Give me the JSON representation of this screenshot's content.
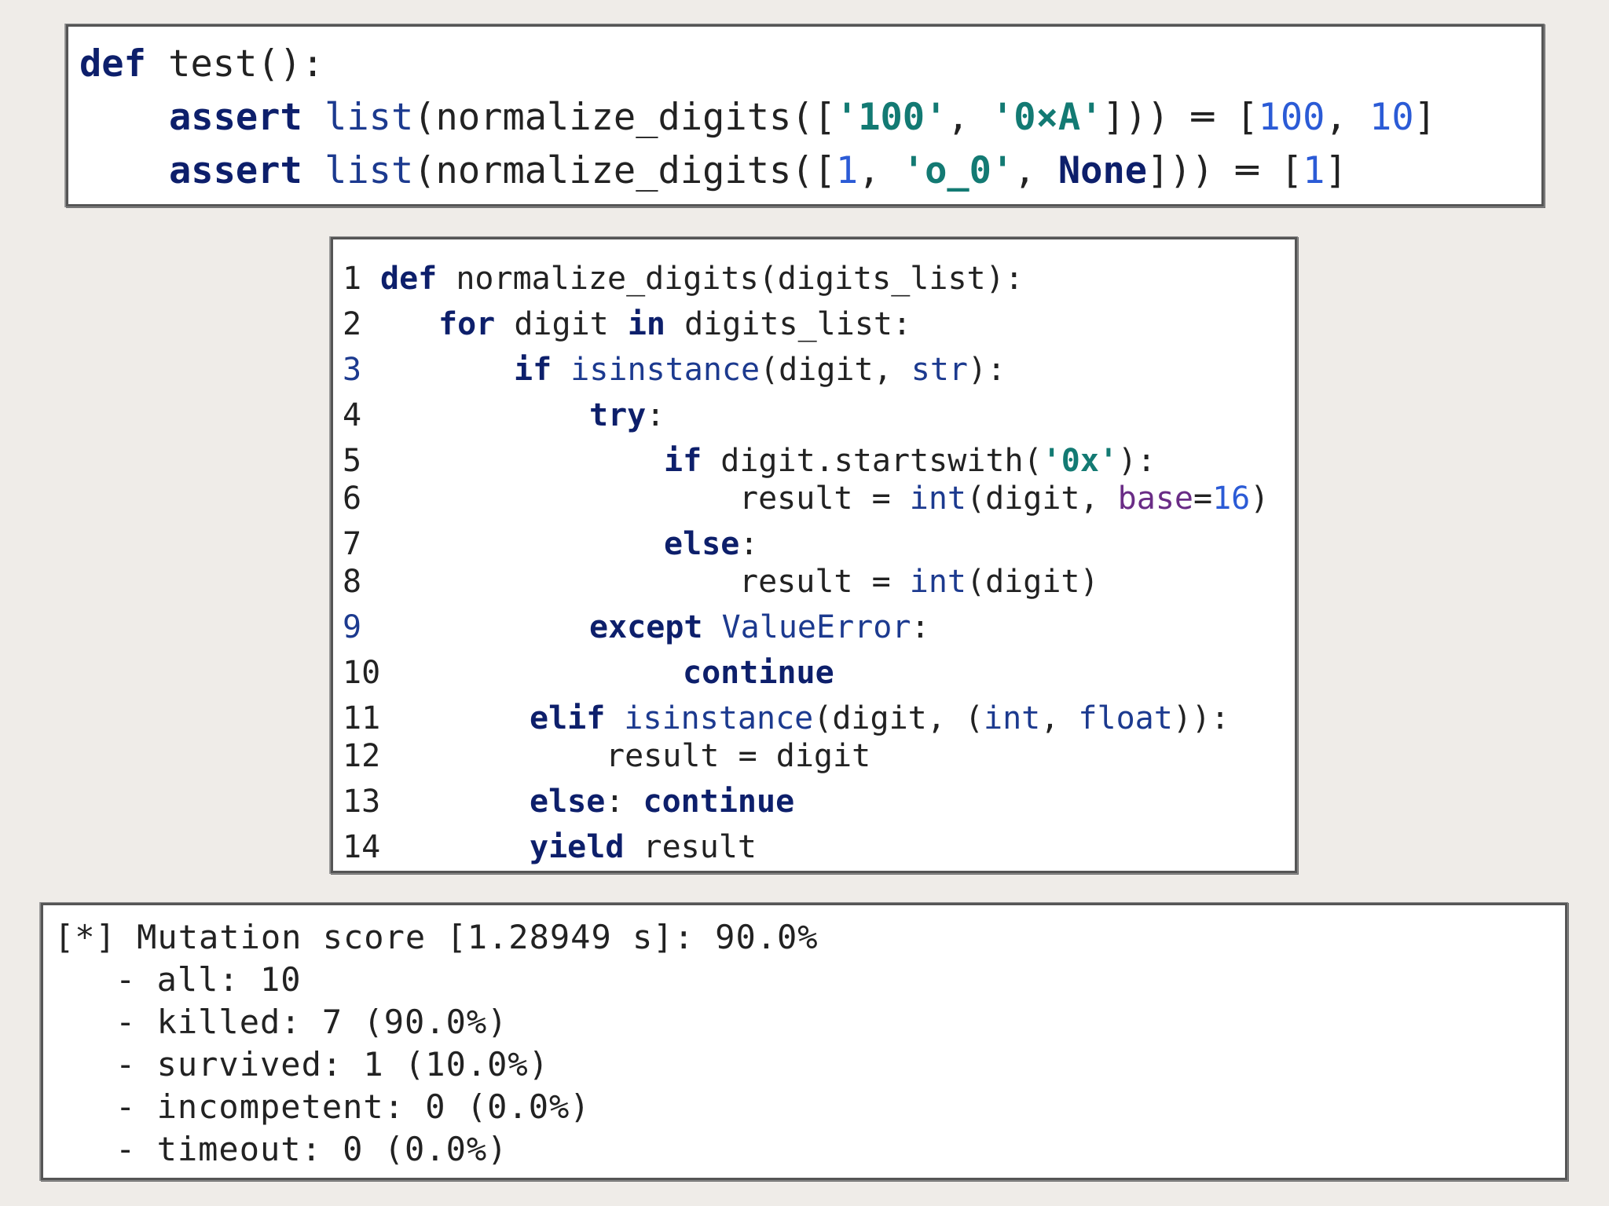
{
  "test_code": {
    "line1": {
      "def": "def",
      "rest": " test():"
    },
    "line2": {
      "assert": "assert",
      "sp": " ",
      "list": "list",
      "p1": "(normalize_digits([",
      "s1": "'100'",
      "comma1": ", ",
      "s2": "'0×A'",
      "p2": "])) ═ [",
      "n1": "100",
      "comma2": ", ",
      "n2": "10",
      "p3": "]"
    },
    "line3": {
      "assert": "assert",
      "sp": " ",
      "list": "list",
      "p1": "(normalize_digits([",
      "n1": "1",
      "comma1": ", ",
      "s1": "'o_0'",
      "comma2": ", ",
      "none": "None",
      "p2": "])) ═ [",
      "n2": "1",
      "p3": "]"
    }
  },
  "source_code": {
    "line_numbers": [
      "1",
      "2",
      "3",
      "4",
      "5",
      "6",
      "7",
      "8",
      "9",
      "10",
      "11",
      "12",
      "13",
      "14"
    ],
    "l1": {
      "kw": "def",
      "rest": " normalize_digits(digits_list):"
    },
    "l2": {
      "kw1": "for",
      "mid": " digit ",
      "kw2": "in",
      "rest": " digits_list:"
    },
    "l3": {
      "kw": "if",
      "sp": " ",
      "bi": "isinstance",
      "mid": "(digit, ",
      "bi2": "str",
      "rest": "):"
    },
    "l4": {
      "kw": "try",
      "rest": ":"
    },
    "l5": {
      "kw": "if",
      "mid": " digit.startswith(",
      "str": "'0x'",
      "rest": "):"
    },
    "l6": {
      "pre": "result = ",
      "bi": "int",
      "mid": "(digit, ",
      "param": "base",
      "eq": "=",
      "num": "16",
      "rest": ")"
    },
    "l7": {
      "kw": "else",
      "rest": ":"
    },
    "l8": {
      "pre": "result = ",
      "bi": "int",
      "rest": "(digit)"
    },
    "l9": {
      "kw": "except",
      "sp": " ",
      "bi": "ValueError",
      "rest": ":"
    },
    "l10": {
      "kw": "continue"
    },
    "l11": {
      "kw": "elif",
      "sp": " ",
      "bi": "isinstance",
      "mid": "(digit, (",
      "bi2": "int",
      "comma": ", ",
      "bi3": "float",
      "rest": ")):"
    },
    "l12": {
      "text": "result = digit"
    },
    "l13": {
      "kw": "else",
      "mid": ": ",
      "kw2": "continue"
    },
    "l14": {
      "kw": "yield",
      "rest": " result"
    }
  },
  "mutation_result": {
    "header": "[*] Mutation score [1.28949 s]: 90.0%",
    "items": [
      "- all: 10",
      "- killed: 7 (90.0%)",
      "- survived: 1 (10.0%)",
      "- incompetent: 0 (0.0%)",
      "- timeout: 0 (0.0%)"
    ]
  }
}
